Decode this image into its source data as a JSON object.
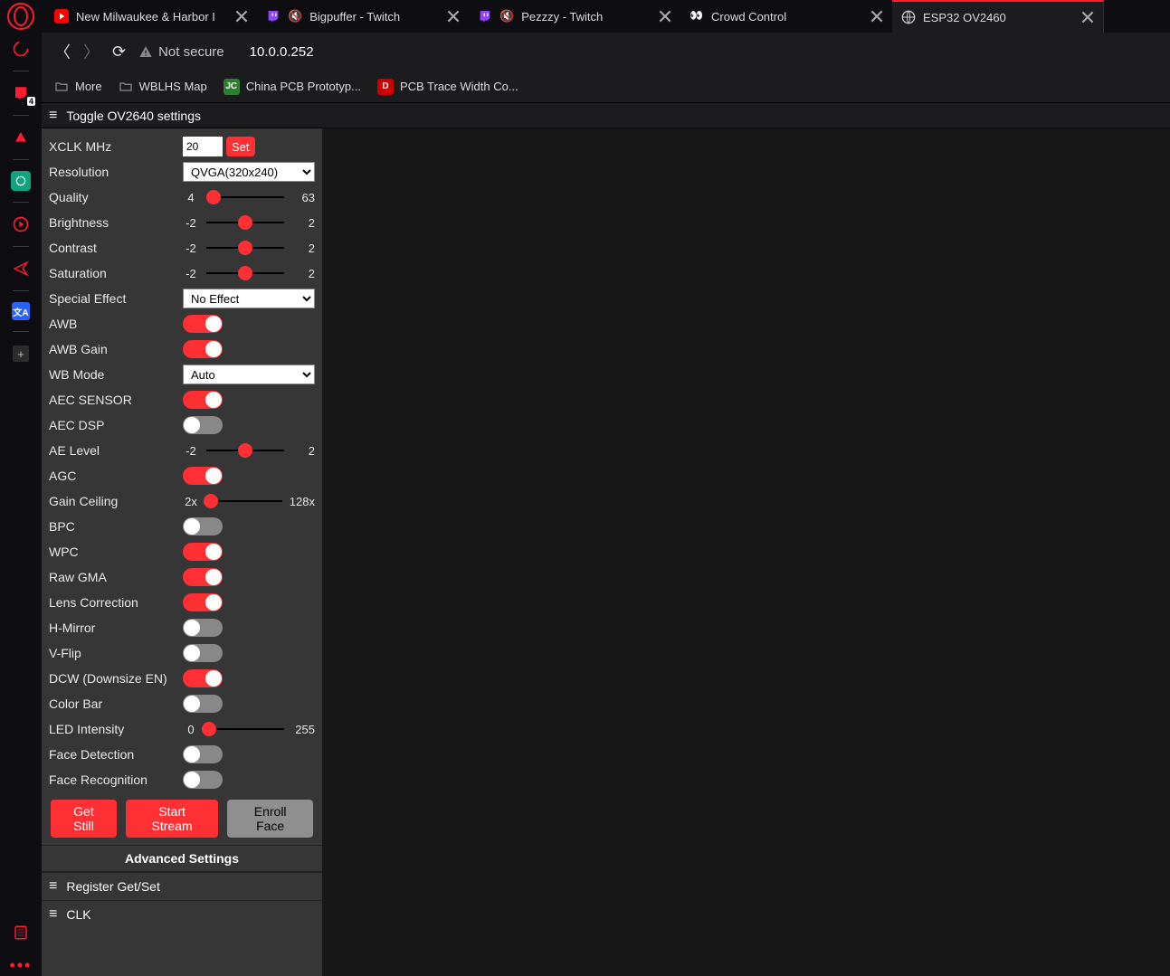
{
  "tabs": [
    {
      "title": "New Milwaukee & Harbor I",
      "type": "youtube"
    },
    {
      "title": "Bigpuffer - Twitch",
      "type": "twitch",
      "muted": true
    },
    {
      "title": "Pezzzy - Twitch",
      "type": "twitch",
      "muted": true
    },
    {
      "title": "Crowd Control",
      "type": "crowd"
    },
    {
      "title": "ESP32 OV2460",
      "type": "globe",
      "active": true
    }
  ],
  "address": {
    "not_secure": "Not secure",
    "url": "10.0.0.252"
  },
  "bookmarks": {
    "more": "More",
    "items": [
      {
        "label": "WBLHS Map",
        "icon": "folder"
      },
      {
        "label": "China PCB Prototyp...",
        "icon": "jlc"
      },
      {
        "label": "PCB Trace Width Co...",
        "icon": "digikey"
      }
    ]
  },
  "panel": {
    "header": "Toggle OV2640 settings",
    "xclk": {
      "label": "XCLK MHz",
      "value": "20",
      "set": "Set"
    },
    "resolution": {
      "label": "Resolution",
      "value": "QVGA(320x240)"
    },
    "quality": {
      "label": "Quality",
      "min": "4",
      "max": "63",
      "pos": 9
    },
    "brightness": {
      "label": "Brightness",
      "min": "-2",
      "max": "2",
      "pos": 50
    },
    "contrast": {
      "label": "Contrast",
      "min": "-2",
      "max": "2",
      "pos": 50
    },
    "saturation": {
      "label": "Saturation",
      "min": "-2",
      "max": "2",
      "pos": 50
    },
    "special_effect": {
      "label": "Special Effect",
      "value": "No Effect"
    },
    "awb": {
      "label": "AWB",
      "on": true
    },
    "awb_gain": {
      "label": "AWB Gain",
      "on": true
    },
    "wb_mode": {
      "label": "WB Mode",
      "value": "Auto"
    },
    "aec_sensor": {
      "label": "AEC SENSOR",
      "on": true
    },
    "aec_dsp": {
      "label": "AEC DSP",
      "on": false
    },
    "ae_level": {
      "label": "AE Level",
      "min": "-2",
      "max": "2",
      "pos": 50
    },
    "agc": {
      "label": "AGC",
      "on": true
    },
    "gain_ceiling": {
      "label": "Gain Ceiling",
      "min": "2x",
      "max": "128x",
      "pos": 6
    },
    "bpc": {
      "label": "BPC",
      "on": false
    },
    "wpc": {
      "label": "WPC",
      "on": true
    },
    "raw_gma": {
      "label": "Raw GMA",
      "on": true
    },
    "lens_corr": {
      "label": "Lens Correction",
      "on": true
    },
    "hmirror": {
      "label": "H-Mirror",
      "on": false
    },
    "vflip": {
      "label": "V-Flip",
      "on": false
    },
    "dcw": {
      "label": "DCW (Downsize EN)",
      "on": true
    },
    "color_bar": {
      "label": "Color Bar",
      "on": false
    },
    "led": {
      "label": "LED Intensity",
      "min": "0",
      "max": "255",
      "pos": 4
    },
    "face_det": {
      "label": "Face Detection",
      "on": false
    },
    "face_rec": {
      "label": "Face Recognition",
      "on": false
    },
    "actions": {
      "get_still": "Get Still",
      "start_stream": "Start Stream",
      "enroll_face": "Enroll Face"
    },
    "advanced": "Advanced Settings",
    "register": "Register Get/Set",
    "clk": "CLK"
  }
}
